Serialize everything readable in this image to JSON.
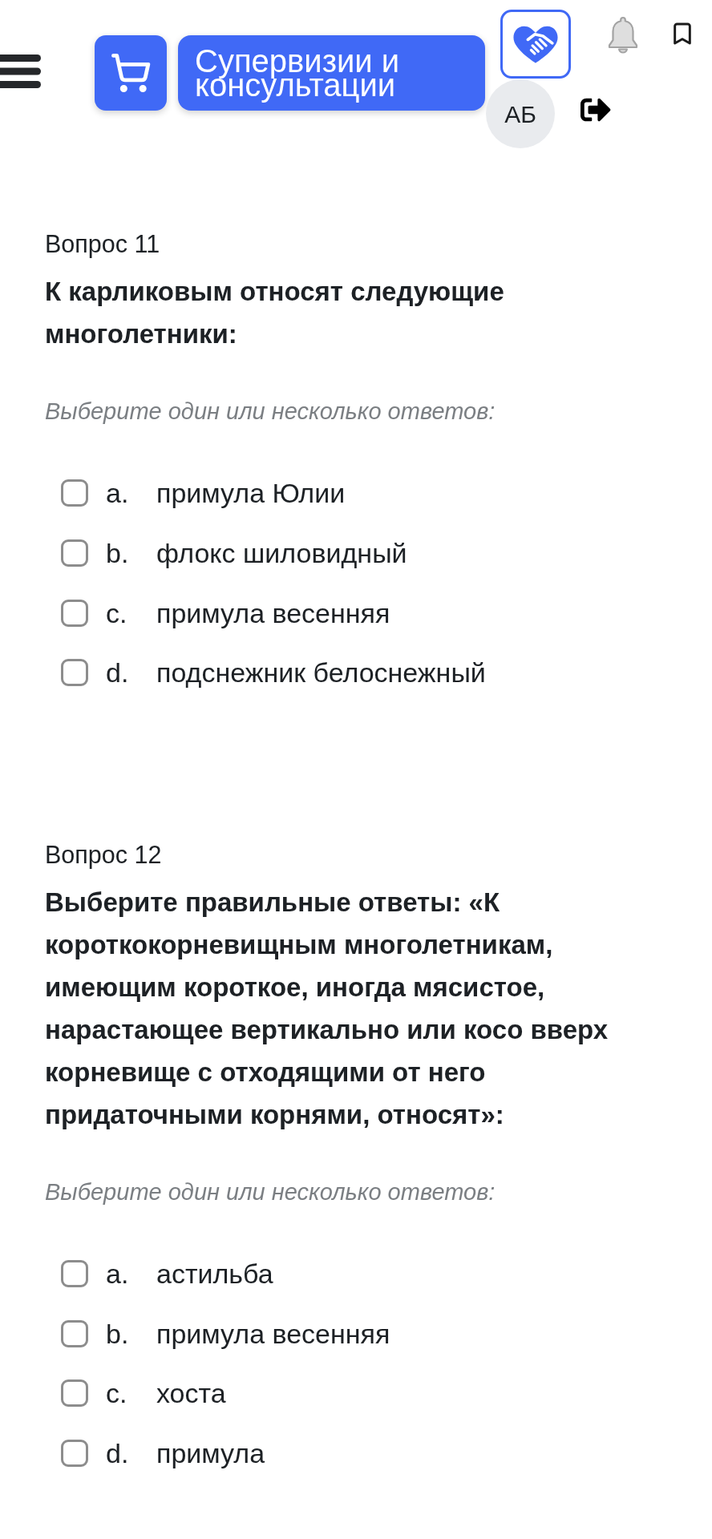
{
  "header": {
    "title": "Супервизии и консультации",
    "avatar_initials": "АБ"
  },
  "questions": [
    {
      "label": "Вопрос 11",
      "text": "К карликовым относят следующие многолетники:",
      "prompt": "Выберите один или несколько ответов:",
      "options": [
        {
          "letter": "a.",
          "text": "примула Юлии",
          "checked": false
        },
        {
          "letter": "b.",
          "text": "флокс шиловидный",
          "checked": false
        },
        {
          "letter": "c.",
          "text": "примула весенняя",
          "checked": false
        },
        {
          "letter": "d.",
          "text": "подснежник белоснежный",
          "checked": false
        }
      ]
    },
    {
      "label": "Вопрос 12",
      "text": "Выберите правильные ответы: «К короткокорневищным многолетникам, имеющим короткое, иногда мясистое, нарастающее вертикально или косо вверх корневище с отходящими от него придаточными корнями, относят»:",
      "prompt": "Выберите один или несколько ответов:",
      "options": [
        {
          "letter": "a.",
          "text": "астильба",
          "checked": false
        },
        {
          "letter": "b.",
          "text": "примула весенняя",
          "checked": false
        },
        {
          "letter": "c.",
          "text": "хоста",
          "checked": false
        },
        {
          "letter": "d.",
          "text": "примула",
          "checked": false
        }
      ]
    }
  ]
}
